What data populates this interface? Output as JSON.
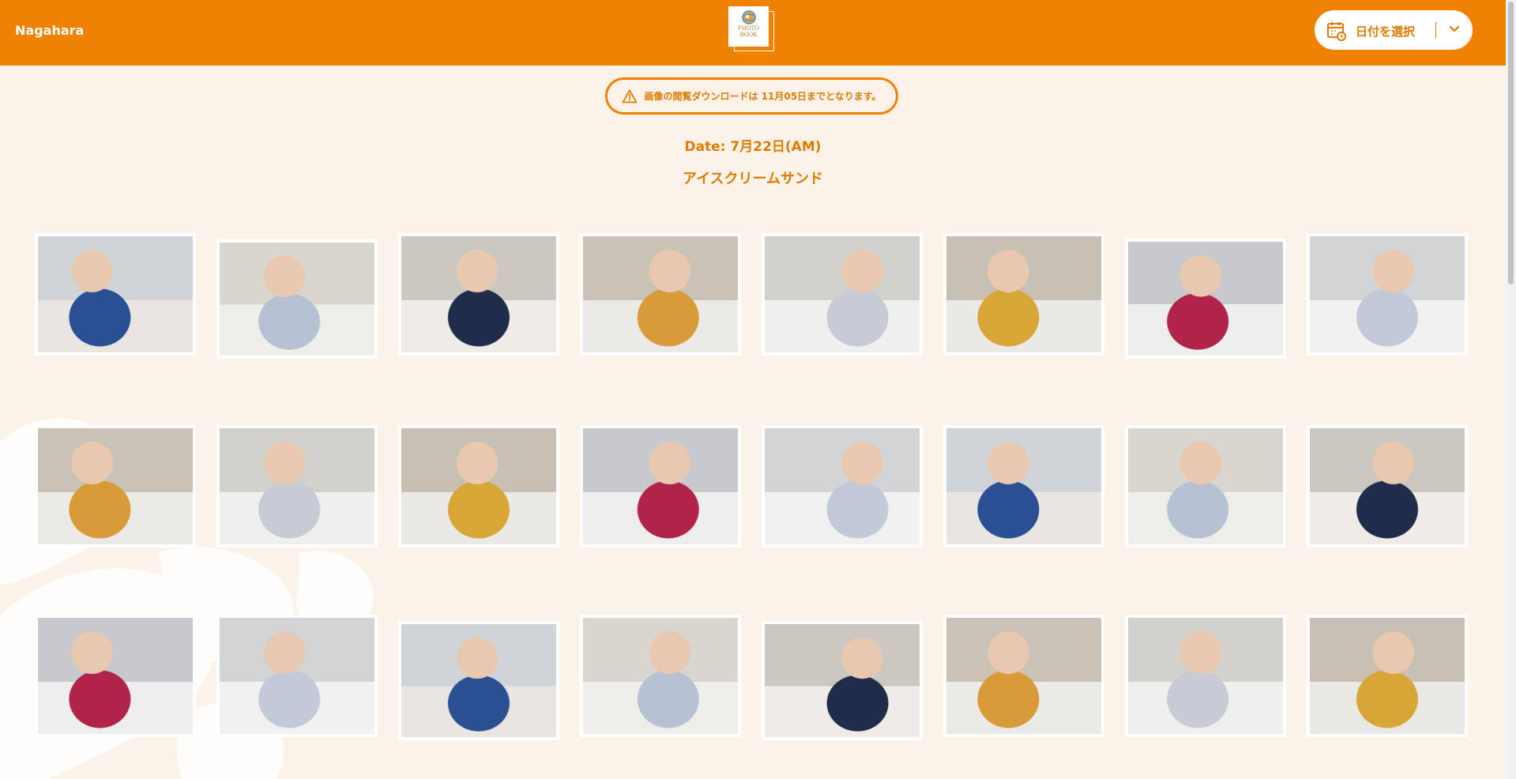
{
  "header": {
    "brand": "Nagahara",
    "logo_text": "PHOTO\nBOOK",
    "date_select_label": "日付を選択"
  },
  "notice": {
    "text": "画像の閲覧ダウンロードは 11月05日までとなります。"
  },
  "session": {
    "date_line": "Date: 7月22日(AM)",
    "event_title": "アイスクリームサンド"
  },
  "colors": {
    "accent": "#ef8200",
    "accent_text": "#e07a00",
    "page_bg": "#fbf3ea"
  },
  "icons": {
    "warning": "warning-icon",
    "calendar": "calendar-icon",
    "chevron": "chevron-down-icon",
    "logo": "photobook-logo"
  },
  "photos_count": 24
}
